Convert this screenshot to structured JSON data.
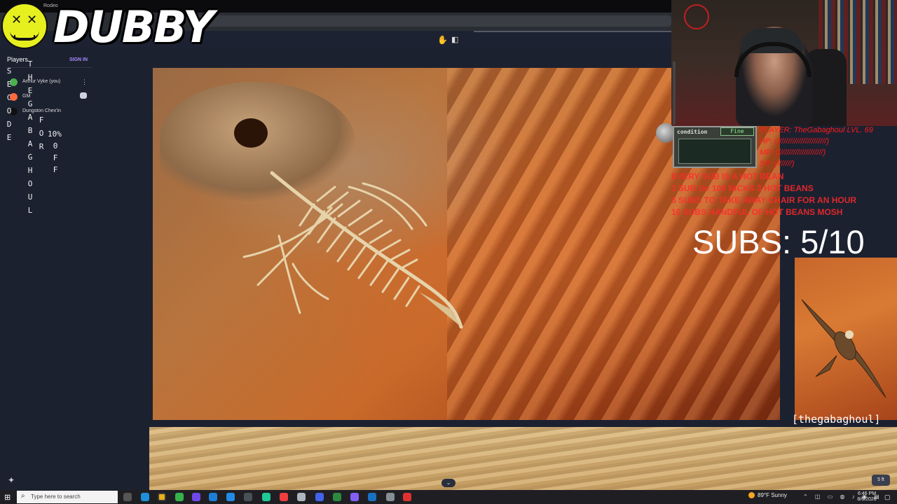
{
  "browser": {
    "tab_title": "Rodeo"
  },
  "overlay": {
    "logo_text": "DUBBY"
  },
  "players": {
    "header": "Players",
    "sign_in": "SIGN IN",
    "list": [
      {
        "name": "Arthur Vyke (you)",
        "color": "#4caf50"
      },
      {
        "name": "GM",
        "color": "#ff6a3d"
      },
      {
        "name": "Dungston Chex'in",
        "color": "#111111"
      }
    ]
  },
  "vertical_text": {
    "col1": [
      "S",
      "E",
      "C",
      "O",
      "D",
      "E"
    ],
    "col2": [
      "T",
      "H",
      "E",
      "G",
      "A",
      "B",
      "A",
      "G",
      "H",
      "O",
      "U",
      "L"
    ],
    "col3": [
      "F",
      "O",
      "R"
    ],
    "pct": "10%",
    "col4": [
      "0",
      "F",
      "F"
    ]
  },
  "stats": {
    "player": "PLAYER: TheGabaghoul LVL. 69",
    "hp": "HP:   (///////////////////////)",
    "mp": "MP:   (/////////////////////)",
    "sp": "SP:  (///////)"
  },
  "scanner": {
    "label": "condition",
    "status": "Fine"
  },
  "sub_rules": [
    "EVERY SUB IS A HOT BEAN",
    "1 SUB for 100 NICKS  3 HOT BEANS",
    "5 SUBS TO TAKE AWAY CHAIR FOR AN HOUR",
    "10 SUBS HANDFUL OF HOT BEANS MOSH"
  ],
  "subs_counter": "SUBS: 5/10",
  "handle": "[thegabaghoul]",
  "zoom_badge": "5 ft",
  "taskbar": {
    "search_placeholder": "Type here to search",
    "weather": "89°F Sunny",
    "time": "6:46 PM",
    "date": "8/6/2026"
  }
}
